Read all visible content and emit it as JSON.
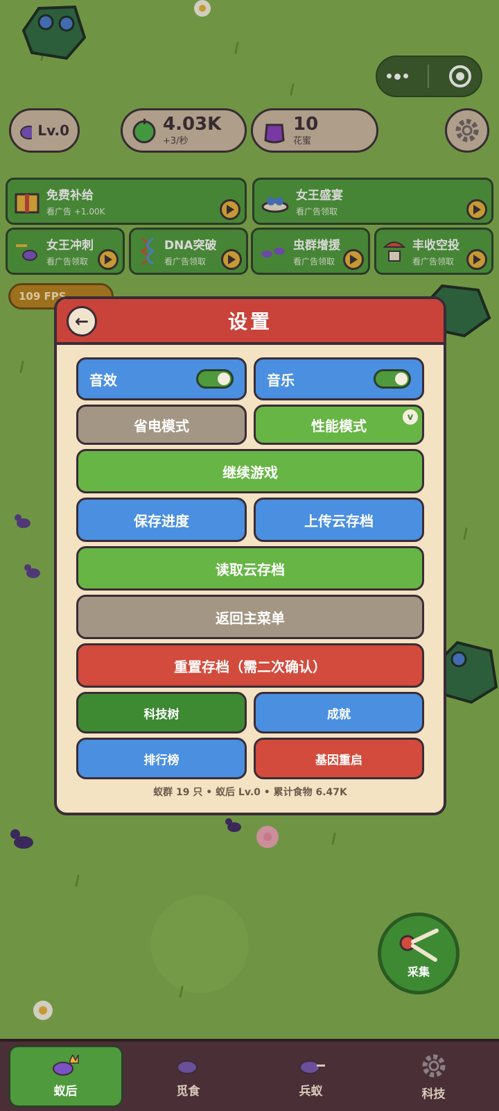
{
  "top_stats": {
    "queen_level": "Lv.0",
    "food_amount": "4.03K",
    "food_rate": "+3/秒",
    "nectar_amount": "10",
    "nectar_label": "花蜜"
  },
  "reward_cards": [
    {
      "title": "免费补给",
      "subtitle": "看广告 +1.00K"
    },
    {
      "title": "女王盛宴",
      "subtitle": "看广告领取"
    },
    {
      "title": "女王冲刺",
      "subtitle": "看广告领取"
    },
    {
      "title": "DNA突破",
      "subtitle": "看广告领取"
    },
    {
      "title": "虫群增援",
      "subtitle": "看广告领取"
    },
    {
      "title": "丰收空投",
      "subtitle": "看广告领取"
    }
  ],
  "fps_text": "109 FPS",
  "settings": {
    "title": "设置",
    "sound_label": "音效",
    "music_label": "音乐",
    "power_save_label": "省电模式",
    "performance_label": "性能模式",
    "performance_check": "v",
    "continue_label": "继续游戏",
    "save_label": "保存进度",
    "upload_label": "上传云存档",
    "load_label": "读取云存档",
    "main_menu_label": "返回主菜单",
    "reset_label": "重置存档（需二次确认）",
    "tech_tree_label": "科技树",
    "achievements_label": "成就",
    "leaderboard_label": "排行榜",
    "gene_restart_label": "基因重启",
    "footer_stats": "蚁群 19 只 • 蚁后 Lv.0 • 累计食物 6.47K"
  },
  "collect_label": "采集",
  "bottom_nav": [
    {
      "label": "蚁后"
    },
    {
      "label": "觅食"
    },
    {
      "label": "兵蚁"
    },
    {
      "label": "科技"
    }
  ],
  "colors": {
    "grass": "#7fae4d",
    "modal_header": "#c9433a",
    "modal_body": "#f4e3c3",
    "button_blue": "#4a8fe0",
    "button_green": "#67b545",
    "button_gray": "#a39684",
    "button_red": "#d24b3c",
    "nav_bg": "#4a2f37"
  }
}
